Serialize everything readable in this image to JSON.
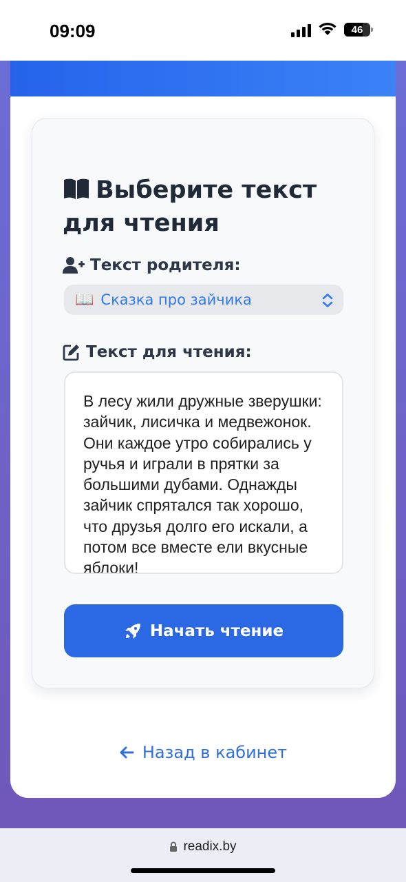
{
  "status": {
    "time": "09:09",
    "battery": "46"
  },
  "form": {
    "title": "Выберите текст для чтения",
    "parent_text_label": "Текст родителя:",
    "selected_story_emoji": "📖",
    "selected_story": "Сказка про зайчика",
    "reading_text_label": "Текст для чтения:",
    "reading_text": "В лесу жили дружные зверушки: зайчик, лисичка и медвежонок. Они каждое утро собирались у ручья и играли в прятки за большими дубами. Однажды зайчик спрятался так хорошо, что друзья долго его искали, а потом все вместе ели вкусные яблоки!",
    "start_button": "Начать чтение"
  },
  "nav": {
    "back_link": "Назад в кабинет"
  },
  "browser": {
    "url": "readix.by"
  },
  "colors": {
    "accent": "#2b68e3",
    "link": "#2f6fde",
    "header_gradient_start": "#2563eb",
    "header_gradient_end": "#3b82f6",
    "background_start": "#6b6fd8",
    "background_end": "#7056b8"
  },
  "icons": {
    "title": "book-open-icon",
    "parent_label": "user-plus-icon",
    "reading_label": "edit-icon",
    "select": "chevron-up-down-icon",
    "start_button": "rocket-icon",
    "back_link": "arrow-left-icon",
    "url": "lock-icon"
  }
}
